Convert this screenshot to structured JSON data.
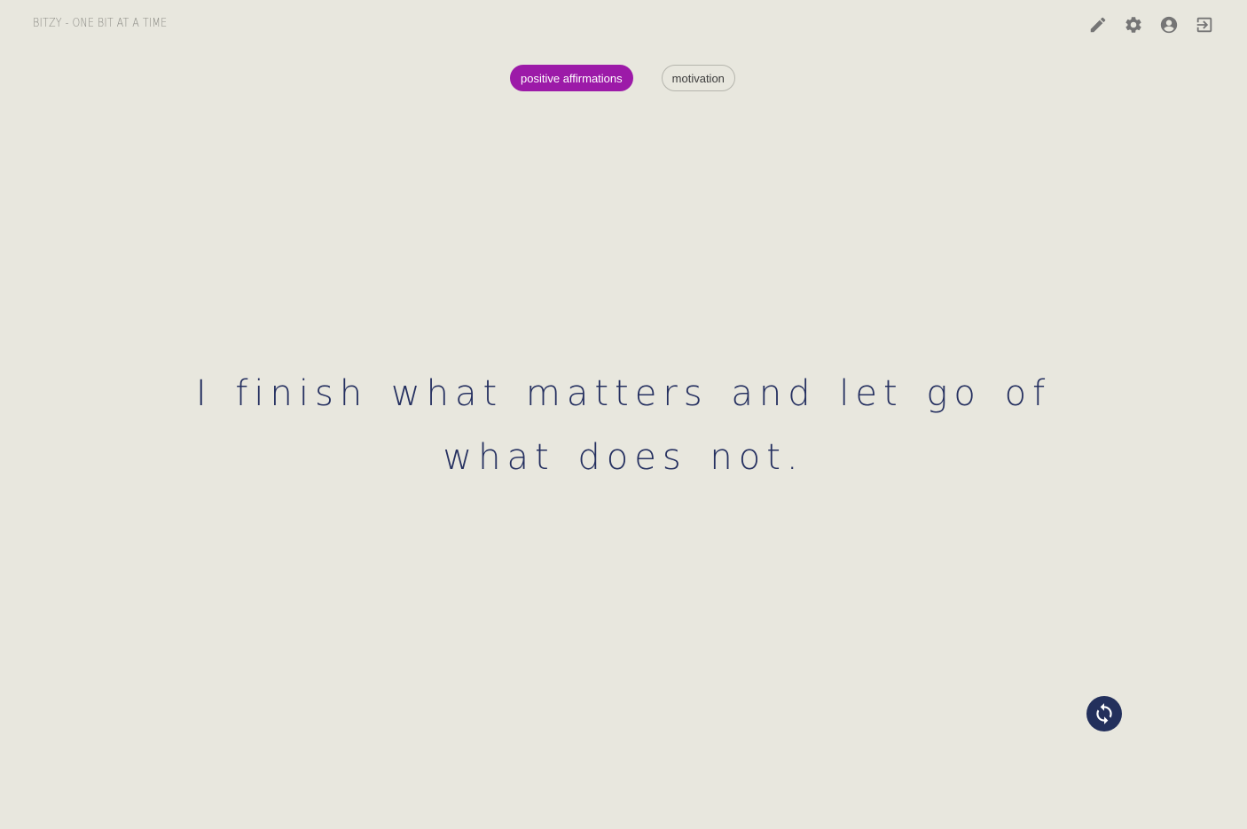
{
  "header": {
    "brand": "BITZY - ONE BIT AT A TIME",
    "tools": [
      {
        "name": "edit-icon"
      },
      {
        "name": "gear-icon"
      },
      {
        "name": "account-icon"
      },
      {
        "name": "logout-icon"
      }
    ]
  },
  "tabs": [
    {
      "label": "positive affirmations",
      "active": true
    },
    {
      "label": "motivation",
      "active": false
    }
  ],
  "quote": {
    "text": "I finish what matters and let go of what does not."
  },
  "refresh": {
    "icon": "refresh-icon"
  },
  "colors": {
    "background": "#e8e7de",
    "accent": "#9c1aa8",
    "quote_text": "#253060",
    "refresh_button": "#23305c"
  }
}
